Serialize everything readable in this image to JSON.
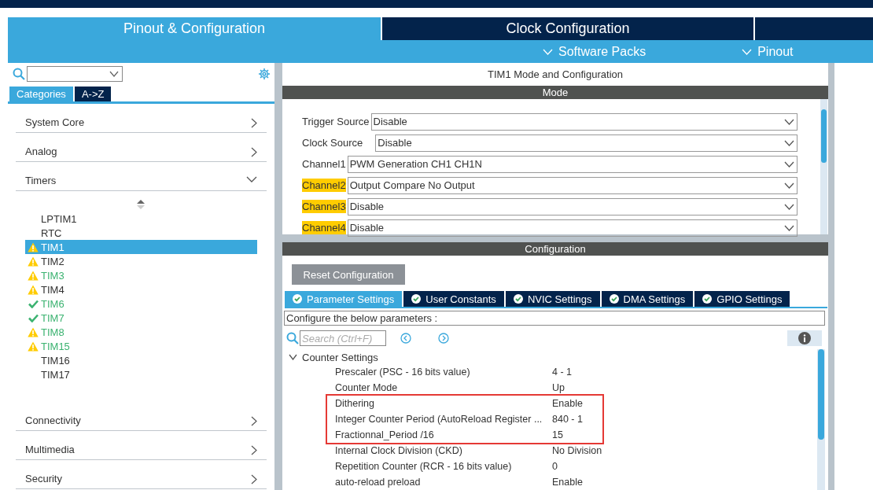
{
  "main_tabs": [
    {
      "label": "Pinout & Configuration",
      "selected": true
    },
    {
      "label": "Clock Configuration",
      "selected": false
    }
  ],
  "menus": [
    {
      "label": "Software Packs"
    },
    {
      "label": "Pinout"
    }
  ],
  "left_panel": {
    "view_tabs": [
      {
        "label": "Categories",
        "selected": true
      },
      {
        "label": "A->Z",
        "selected": false
      }
    ],
    "categories": [
      {
        "label": "System Core",
        "expanded": false
      },
      {
        "label": "Analog",
        "expanded": false
      },
      {
        "label": "Timers",
        "expanded": true,
        "children": [
          {
            "label": "LPTIM1",
            "warning": false,
            "ok": false,
            "configured": false,
            "selected": false
          },
          {
            "label": "RTC",
            "warning": false,
            "ok": false,
            "configured": false,
            "selected": false
          },
          {
            "label": "TIM1",
            "warning": true,
            "ok": false,
            "configured": false,
            "selected": true
          },
          {
            "label": "TIM2",
            "warning": true,
            "ok": false,
            "configured": false,
            "selected": false
          },
          {
            "label": "TIM3",
            "warning": true,
            "ok": false,
            "configured": true,
            "selected": false
          },
          {
            "label": "TIM4",
            "warning": true,
            "ok": false,
            "configured": false,
            "selected": false
          },
          {
            "label": "TIM6",
            "warning": false,
            "ok": true,
            "configured": true,
            "selected": false
          },
          {
            "label": "TIM7",
            "warning": false,
            "ok": true,
            "configured": true,
            "selected": false
          },
          {
            "label": "TIM8",
            "warning": true,
            "ok": false,
            "configured": true,
            "selected": false
          },
          {
            "label": "TIM15",
            "warning": true,
            "ok": false,
            "configured": true,
            "selected": false
          },
          {
            "label": "TIM16",
            "warning": false,
            "ok": false,
            "configured": false,
            "selected": false
          },
          {
            "label": "TIM17",
            "warning": false,
            "ok": false,
            "configured": false,
            "selected": false
          }
        ]
      },
      {
        "label": "Connectivity",
        "expanded": false
      },
      {
        "label": "Multimedia",
        "expanded": false
      },
      {
        "label": "Security",
        "expanded": false
      }
    ]
  },
  "mode_panel": {
    "title": "TIM1 Mode and Configuration",
    "header": "Mode",
    "rows": [
      {
        "label": "Trigger Source",
        "value": "Disable",
        "highlighted": false
      },
      {
        "label": "Clock Source",
        "value": "Disable",
        "highlighted": false
      },
      {
        "label": "Channel1",
        "value": "PWM Generation CH1 CH1N",
        "highlighted": false
      },
      {
        "label": "Channel2",
        "value": "Output Compare No Output",
        "highlighted": true
      },
      {
        "label": "Channel3",
        "value": "Disable",
        "highlighted": true
      },
      {
        "label": "Channel4",
        "value": "Disable",
        "highlighted": true
      }
    ]
  },
  "config_panel": {
    "header": "Configuration",
    "reset_button": "Reset Configuration",
    "tabs": [
      {
        "label": "Parameter Settings",
        "selected": true
      },
      {
        "label": "User Constants",
        "selected": false
      },
      {
        "label": "NVIC Settings",
        "selected": false
      },
      {
        "label": "DMA Settings",
        "selected": false
      },
      {
        "label": "GPIO Settings",
        "selected": false
      }
    ],
    "description": "Configure the below parameters :",
    "search": {
      "placeholder": "Search (Ctrl+F)"
    },
    "groups": [
      {
        "label": "Counter Settings",
        "expanded": true,
        "params": [
          {
            "name": "Prescaler (PSC - 16 bits value)",
            "value": "4 - 1",
            "boxed": false
          },
          {
            "name": "Counter Mode",
            "value": "Up",
            "boxed": false
          },
          {
            "name": "Dithering",
            "value": "Enable",
            "boxed": true
          },
          {
            "name": "Integer Counter Period (AutoReload Register ...",
            "value": "840 - 1",
            "boxed": true
          },
          {
            "name": "Fractionnal_Period /16",
            "value": "15",
            "boxed": true
          },
          {
            "name": "Internal Clock Division (CKD)",
            "value": "No Division",
            "boxed": false
          },
          {
            "name": "Repetition Counter (RCR - 16 bits value)",
            "value": "0",
            "boxed": false
          },
          {
            "name": "auto-reload preload",
            "value": "Enable",
            "boxed": false
          }
        ]
      }
    ]
  }
}
